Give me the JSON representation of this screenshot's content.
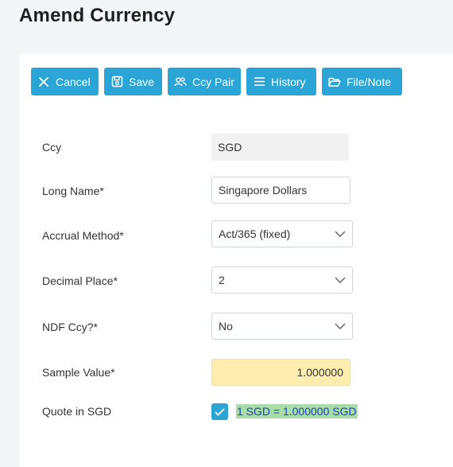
{
  "header": {
    "title": "Amend Currency"
  },
  "toolbar": {
    "cancel_label": "Cancel",
    "save_label": "Save",
    "ccy_pair_label": "Ccy Pair",
    "history_label": "History",
    "file_note_label": "File/Note"
  },
  "form": {
    "ccy": {
      "label": "Ccy",
      "value": "SGD"
    },
    "long_name": {
      "label": "Long Name*",
      "value": "Singapore Dollars"
    },
    "accrual_method": {
      "label": "Accrual Method*",
      "value": "Act/365 (fixed)"
    },
    "decimal_place": {
      "label": "Decimal Place*",
      "value": "2"
    },
    "ndf_ccy": {
      "label": "NDF Ccy?*",
      "value": "No"
    },
    "sample_value": {
      "label": "Sample Value*",
      "value": "1.000000"
    },
    "quote_in": {
      "label": "Quote in SGD",
      "checked": true,
      "text": "1 SGD = 1.000000 SGD"
    }
  },
  "colors": {
    "button_bg": "#2aa5d6",
    "highlight_bg": "#fdeeb0",
    "quote_bg": "#a8dca8",
    "quote_text": "#1b45b8"
  }
}
